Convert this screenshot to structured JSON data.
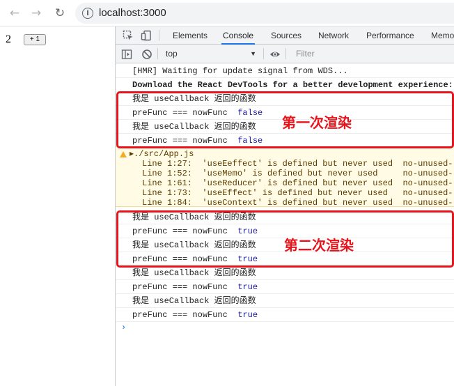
{
  "browser": {
    "url": "localhost:3000",
    "back_icon": "arrow-left-icon",
    "forward_icon": "arrow-right-icon",
    "reload_icon": "reload-icon",
    "info_icon": "info-icon"
  },
  "page": {
    "count": "2",
    "increment_button": "+ 1"
  },
  "devtools": {
    "tabs": [
      "Elements",
      "Console",
      "Sources",
      "Network",
      "Performance",
      "Memo"
    ],
    "active_tab": "Console",
    "context": "top",
    "filter_placeholder": "Filter",
    "console": {
      "hmr": "[HMR] Waiting for update signal from WDS...",
      "react_devtools": "Download the React DevTools for a better development experience:",
      "first_render": [
        {
          "text": "我是 useCallback 返回的函数",
          "bool": ""
        },
        {
          "text": "preFunc === nowFunc  ",
          "bool": "false"
        },
        {
          "text": "我是 useCallback 返回的函数",
          "bool": ""
        },
        {
          "text": "preFunc === nowFunc  ",
          "bool": "false"
        }
      ],
      "warning": {
        "file": "./src/App.js",
        "lines": [
          "Line 1:27:  'useEeffect' is defined but never used  no-unused-",
          "Line 1:52:  'useMemo' is defined but never used     no-unused-",
          "Line 1:61:  'useReducer' is defined but never used  no-unused-",
          "Line 1:73:  'useEffect' is defined but never used   no-unused-",
          "Line 1:84:  'useContext' is defined but never used  no-unused-"
        ]
      },
      "second_render": [
        {
          "text": "我是 useCallback 返回的函数",
          "bool": ""
        },
        {
          "text": "preFunc === nowFunc  ",
          "bool": "true"
        },
        {
          "text": "我是 useCallback 返回的函数",
          "bool": ""
        },
        {
          "text": "preFunc === nowFunc  ",
          "bool": "true"
        }
      ],
      "after": [
        {
          "text": "我是 useCallback 返回的函数",
          "bool": ""
        },
        {
          "text": "preFunc === nowFunc  ",
          "bool": "true"
        },
        {
          "text": "我是 useCallback 返回的函数",
          "bool": ""
        },
        {
          "text": "preFunc === nowFunc  ",
          "bool": "true"
        }
      ],
      "prompt": "›"
    }
  },
  "annotations": {
    "first_render_label": "第一次渲染",
    "second_render_label": "第二次渲染",
    "color": "#e8141b"
  }
}
